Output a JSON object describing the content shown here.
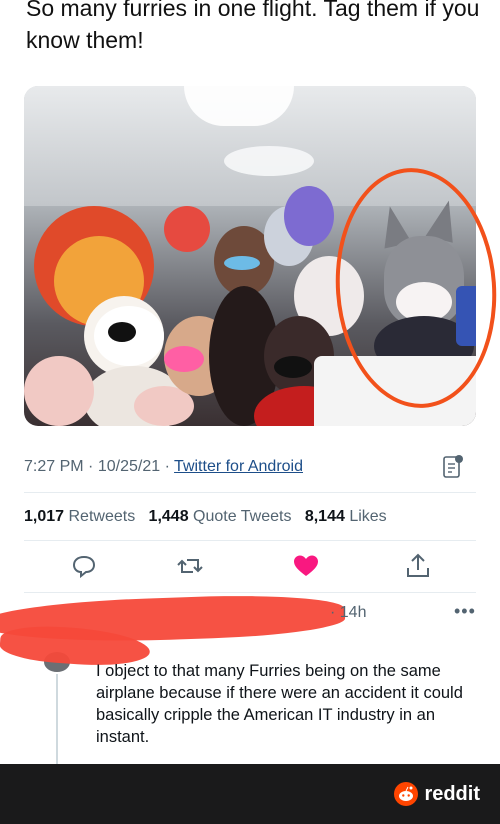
{
  "tweet": {
    "text": "So many furries in one flight. Tag them if you know them!",
    "time": "7:27 PM",
    "date": "10/25/21",
    "separator": "·",
    "source": "Twitter for Android",
    "stats": {
      "retweets_count": "1,017",
      "retweets_label": "Retweets",
      "quotes_count": "1,448",
      "quotes_label": "Quote Tweets",
      "likes_count": "8,144",
      "likes_label": "Likes"
    },
    "like_color": "#f91880",
    "annotation_color": "#f2511b"
  },
  "reply": {
    "time": "· 14h",
    "more": "•••",
    "text": "I object to that many Furries being on the same airplane because if there were an accident it could basically cripple the American IT industry in an instant.",
    "redaction_color": "#f6493a"
  },
  "footer": {
    "brand": "reddit",
    "brand_color": "#ff4500"
  },
  "icons": [
    "reply-icon",
    "retweet-icon",
    "like-icon",
    "share-icon",
    "analytics-icon",
    "reddit-snoo-icon"
  ]
}
